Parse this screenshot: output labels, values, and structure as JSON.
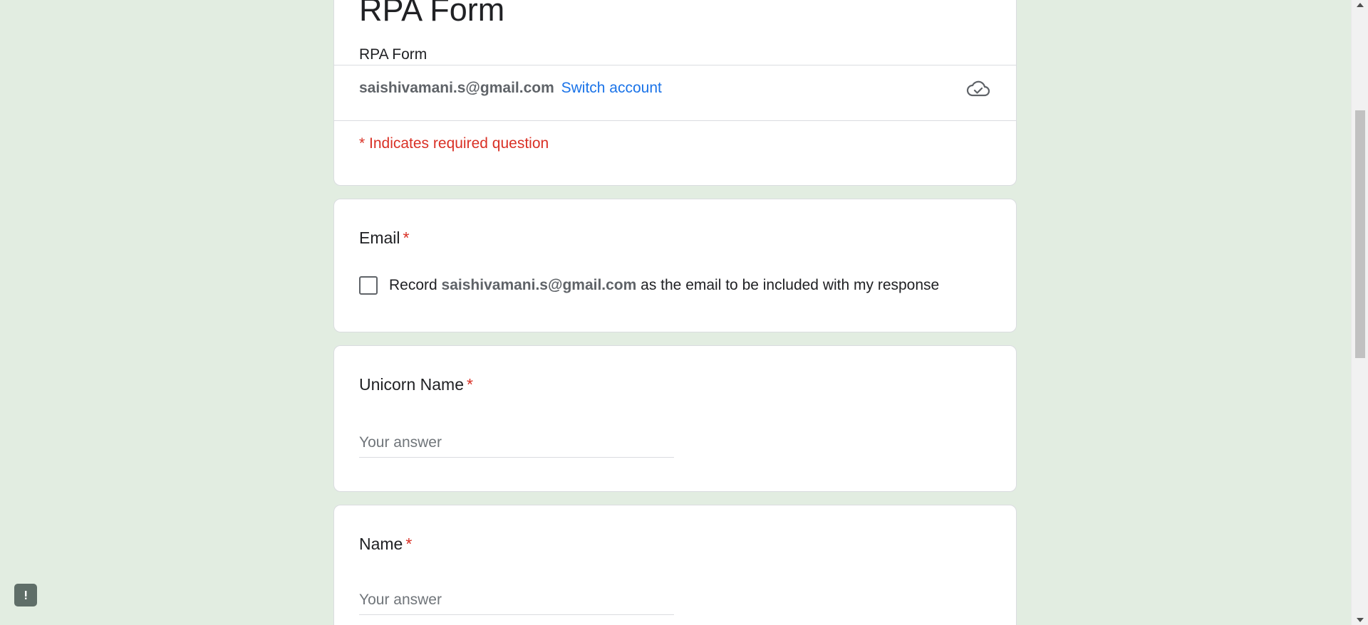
{
  "form": {
    "title": "RPA Form",
    "description": "RPA Form",
    "account_email": "saishivamani.s@gmail.com",
    "switch_account_label": "Switch account",
    "required_note": "* Indicates required question"
  },
  "questions": {
    "email": {
      "label": "Email",
      "required_mark": "*",
      "record_prefix": "Record",
      "record_email": "saishivamani.s@gmail.com",
      "record_suffix": "as the email to be included with my response"
    },
    "unicorn_name": {
      "label": "Unicorn Name",
      "required_mark": "*",
      "placeholder": "Your answer"
    },
    "name": {
      "label": "Name",
      "required_mark": "*",
      "placeholder": "Your answer"
    }
  },
  "icons": {
    "cloud": "cloud-check-icon",
    "feedback": "feedback-icon"
  },
  "colors": {
    "background": "#e2ede1",
    "required": "#d93025",
    "link": "#1a73e8"
  }
}
